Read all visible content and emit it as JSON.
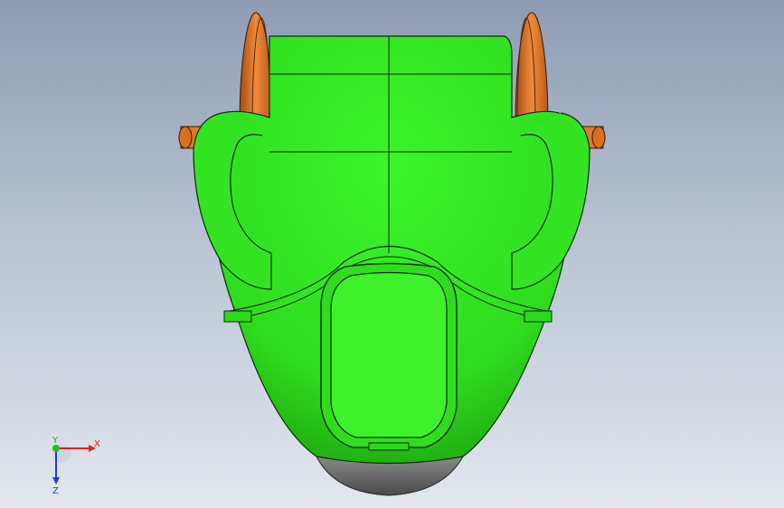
{
  "triad": {
    "x_label": "X",
    "y_label": "Y",
    "z_label": "Z"
  },
  "colors": {
    "body": "#33e620",
    "body_dark": "#1f9e10",
    "wheel": "#e0782a",
    "wheel_dark": "#a24c12",
    "tip": "#6e6e6e",
    "x_axis": "#e02020",
    "y_axis": "#20c020",
    "z_axis": "#2040d0"
  }
}
